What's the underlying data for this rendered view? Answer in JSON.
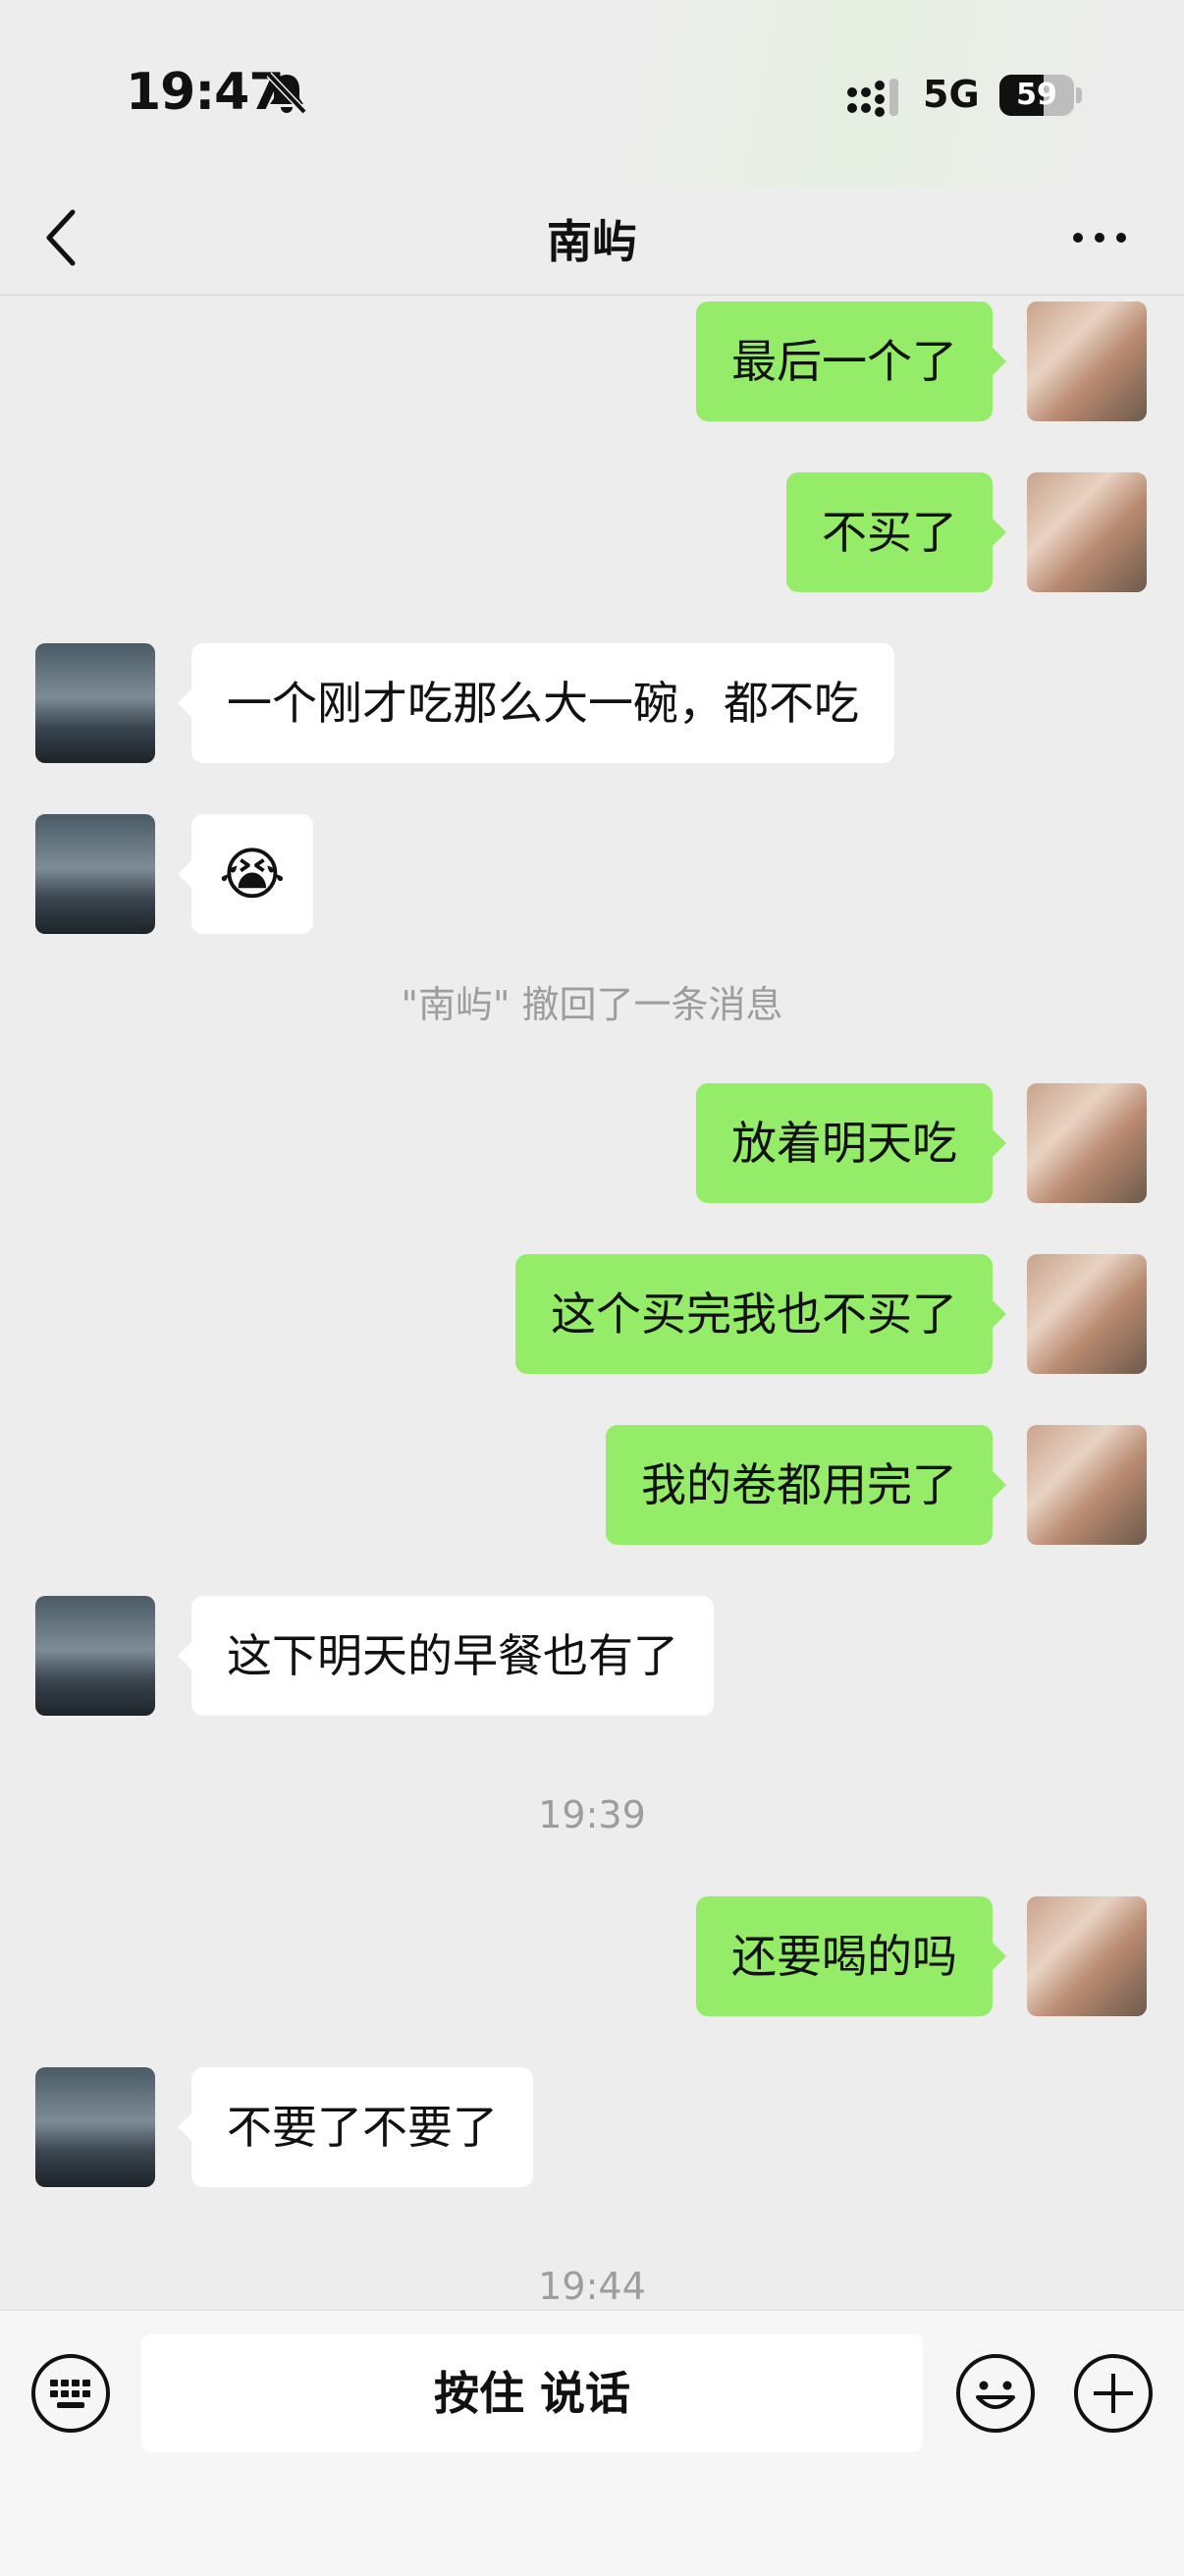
{
  "status_bar": {
    "time": "19:47",
    "network": "5G",
    "battery": "59",
    "battery_level": 0.59
  },
  "nav": {
    "title": "南屿"
  },
  "messages": [
    {
      "side": "right",
      "text": "最后一个了"
    },
    {
      "side": "right",
      "text": "不买了"
    },
    {
      "side": "left",
      "text": "一个刚才吃那么大一碗，都不吃"
    },
    {
      "side": "left",
      "text": "😭"
    },
    {
      "type": "system",
      "text": "\"南屿\" 撤回了一条消息"
    },
    {
      "side": "right",
      "text": "放着明天吃"
    },
    {
      "side": "right",
      "text": "这个买完我也不买了"
    },
    {
      "side": "right",
      "text": "我的卷都用完了"
    },
    {
      "side": "left",
      "text": "这下明天的早餐也有了"
    },
    {
      "type": "time",
      "text": "19:39"
    },
    {
      "side": "right",
      "text": "还要喝的吗"
    },
    {
      "side": "left",
      "text": "不要了不要了"
    },
    {
      "type": "time",
      "text": "19:44"
    }
  ],
  "input_bar": {
    "hold_to_talk": "按住 说话"
  },
  "icons": {
    "back": "chevron-left-icon",
    "more": "more-dots-icon",
    "bell": "bell-muted-icon",
    "keyboard": "keyboard-icon",
    "emoji": "emoji-icon",
    "plus": "plus-icon"
  },
  "colors": {
    "sent_bubble": "#95ec69",
    "received_bubble": "#ffffff",
    "background": "#ededed"
  }
}
